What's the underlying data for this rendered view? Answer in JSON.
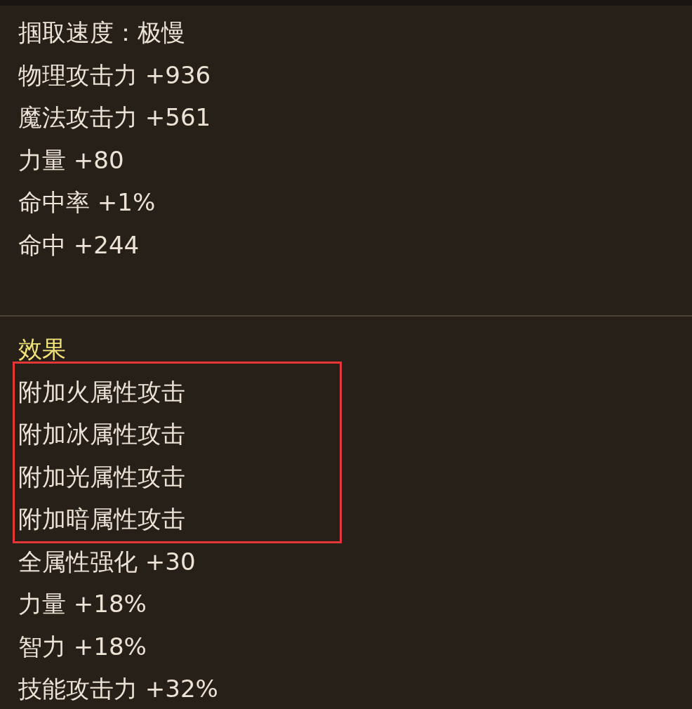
{
  "stats": [
    "掴取速度：极慢",
    "物理攻击力 +936",
    "魔法攻击力 +561",
    "力量 +80",
    "命中率 +1%",
    "命中 +244"
  ],
  "effects": {
    "title": "效果",
    "highlighted_lines": [
      "附加火属性攻击",
      "附加冰属性攻击",
      "附加光属性攻击",
      "附加暗属性攻击"
    ],
    "lines": [
      "全属性强化 +30",
      "力量 +18%",
      "智力 +18%",
      "技能攻击力 +32%"
    ]
  }
}
